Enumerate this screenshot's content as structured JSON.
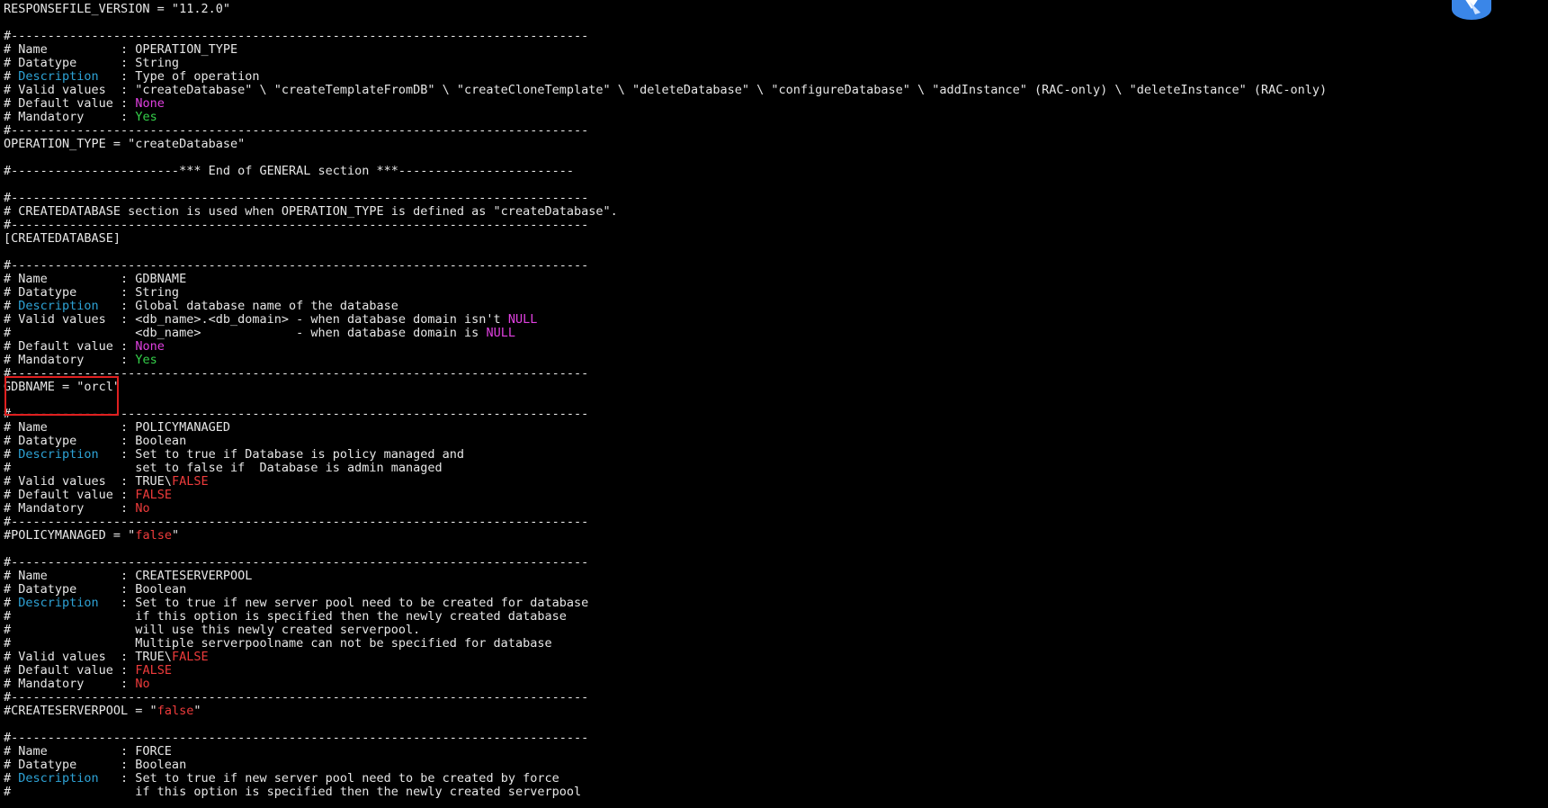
{
  "colors": {
    "background": "#000000",
    "text": "#e6e6e6",
    "keyword": "#2ea3d6",
    "none_null": "#e040e0",
    "yes": "#35d14a",
    "false_no": "#ee3b3b",
    "highlight_box": "#e02020",
    "corner_icon": "#3a86e8"
  },
  "corner_icon": {
    "icon": "blue-app-badge-icon"
  },
  "highlight": {
    "target_line": "GDBNAME = \"orcl\""
  },
  "lines": [
    [
      [
        "RESPONSEFILE_VERSION = \"11.2.0\"",
        "default"
      ]
    ],
    [
      [
        "",
        "default"
      ]
    ],
    [
      [
        "#-------------------------------------------------------------------------------",
        "default"
      ]
    ],
    [
      [
        "# Name          : OPERATION_TYPE",
        "default"
      ]
    ],
    [
      [
        "# Datatype      : String",
        "default"
      ]
    ],
    [
      [
        "# ",
        "default"
      ],
      [
        "Description",
        "blue"
      ],
      [
        "   : Type of operation",
        "default"
      ]
    ],
    [
      [
        "# Valid values  : \"createDatabase\" \\ \"createTemplateFromDB\" \\ \"createCloneTemplate\" \\ \"deleteDatabase\" \\ \"configureDatabase\" \\ \"addInstance\" (RAC-only) \\ \"deleteInstance\" (RAC-only)",
        "default"
      ]
    ],
    [
      [
        "# Default value : ",
        "default"
      ],
      [
        "None",
        "magenta"
      ]
    ],
    [
      [
        "# Mandatory     : ",
        "default"
      ],
      [
        "Yes",
        "green"
      ]
    ],
    [
      [
        "#-------------------------------------------------------------------------------",
        "default"
      ]
    ],
    [
      [
        "OPERATION_TYPE = \"createDatabase\"",
        "default"
      ]
    ],
    [
      [
        "",
        "default"
      ]
    ],
    [
      [
        "#-----------------------*** End of GENERAL section ***------------------------",
        "default"
      ]
    ],
    [
      [
        "",
        "default"
      ]
    ],
    [
      [
        "#-------------------------------------------------------------------------------",
        "default"
      ]
    ],
    [
      [
        "# CREATEDATABASE section is used when OPERATION_TYPE is defined as \"createDatabase\".",
        "default"
      ]
    ],
    [
      [
        "#-------------------------------------------------------------------------------",
        "default"
      ]
    ],
    [
      [
        "[CREATEDATABASE]",
        "default"
      ]
    ],
    [
      [
        "",
        "default"
      ]
    ],
    [
      [
        "#-------------------------------------------------------------------------------",
        "default"
      ]
    ],
    [
      [
        "# Name          : GDBNAME",
        "default"
      ]
    ],
    [
      [
        "# Datatype      : String",
        "default"
      ]
    ],
    [
      [
        "# ",
        "default"
      ],
      [
        "Description",
        "blue"
      ],
      [
        "   : Global database name of the database",
        "default"
      ]
    ],
    [
      [
        "# Valid values  : <db_name>.<db_domain> - when database domain isn't ",
        "default"
      ],
      [
        "NULL",
        "magenta"
      ]
    ],
    [
      [
        "#                 <db_name>             - when database domain is ",
        "default"
      ],
      [
        "NULL",
        "magenta"
      ]
    ],
    [
      [
        "# Default value : ",
        "default"
      ],
      [
        "None",
        "magenta"
      ]
    ],
    [
      [
        "# Mandatory     : ",
        "default"
      ],
      [
        "Yes",
        "green"
      ]
    ],
    [
      [
        "#-------------------------------------------------------------------------------",
        "default"
      ]
    ],
    [
      [
        "GDBNAME = \"orcl\"",
        "default"
      ]
    ],
    [
      [
        "",
        "default"
      ]
    ],
    [
      [
        "#-------------------------------------------------------------------------------",
        "default"
      ]
    ],
    [
      [
        "# Name          : POLICYMANAGED",
        "default"
      ]
    ],
    [
      [
        "# Datatype      : Boolean",
        "default"
      ]
    ],
    [
      [
        "# ",
        "default"
      ],
      [
        "Description",
        "blue"
      ],
      [
        "   : Set to true if Database is policy managed and",
        "default"
      ]
    ],
    [
      [
        "#                 set to false if  Database is admin managed",
        "default"
      ]
    ],
    [
      [
        "# Valid values  : TRUE\\",
        "default"
      ],
      [
        "FALSE",
        "red"
      ]
    ],
    [
      [
        "# Default value : ",
        "default"
      ],
      [
        "FALSE",
        "red"
      ]
    ],
    [
      [
        "# Mandatory     : ",
        "default"
      ],
      [
        "No",
        "red"
      ]
    ],
    [
      [
        "#-------------------------------------------------------------------------------",
        "default"
      ]
    ],
    [
      [
        "#POLICYMANAGED = \"",
        "default"
      ],
      [
        "false",
        "red"
      ],
      [
        "\"",
        "default"
      ]
    ],
    [
      [
        "",
        "default"
      ]
    ],
    [
      [
        "#-------------------------------------------------------------------------------",
        "default"
      ]
    ],
    [
      [
        "# Name          : CREATESERVERPOOL",
        "default"
      ]
    ],
    [
      [
        "# Datatype      : Boolean",
        "default"
      ]
    ],
    [
      [
        "# ",
        "default"
      ],
      [
        "Description",
        "blue"
      ],
      [
        "   : Set to true if new server pool need to be created for database",
        "default"
      ]
    ],
    [
      [
        "#                 if this option is specified then the newly created database",
        "default"
      ]
    ],
    [
      [
        "#                 will use this newly created serverpool.",
        "default"
      ]
    ],
    [
      [
        "#                 Multiple serverpoolname can not be specified for database",
        "default"
      ]
    ],
    [
      [
        "# Valid values  : TRUE\\",
        "default"
      ],
      [
        "FALSE",
        "red"
      ]
    ],
    [
      [
        "# Default value : ",
        "default"
      ],
      [
        "FALSE",
        "red"
      ]
    ],
    [
      [
        "# Mandatory     : ",
        "default"
      ],
      [
        "No",
        "red"
      ]
    ],
    [
      [
        "#-------------------------------------------------------------------------------",
        "default"
      ]
    ],
    [
      [
        "#CREATESERVERPOOL = \"",
        "default"
      ],
      [
        "false",
        "red"
      ],
      [
        "\"",
        "default"
      ]
    ],
    [
      [
        "",
        "default"
      ]
    ],
    [
      [
        "#-------------------------------------------------------------------------------",
        "default"
      ]
    ],
    [
      [
        "# Name          : FORCE",
        "default"
      ]
    ],
    [
      [
        "# Datatype      : Boolean",
        "default"
      ]
    ],
    [
      [
        "# ",
        "default"
      ],
      [
        "Description",
        "blue"
      ],
      [
        "   : Set to true if new server pool need to be created by force",
        "default"
      ]
    ],
    [
      [
        "#                 if this option is specified then the newly created serverpool",
        "default"
      ]
    ]
  ]
}
